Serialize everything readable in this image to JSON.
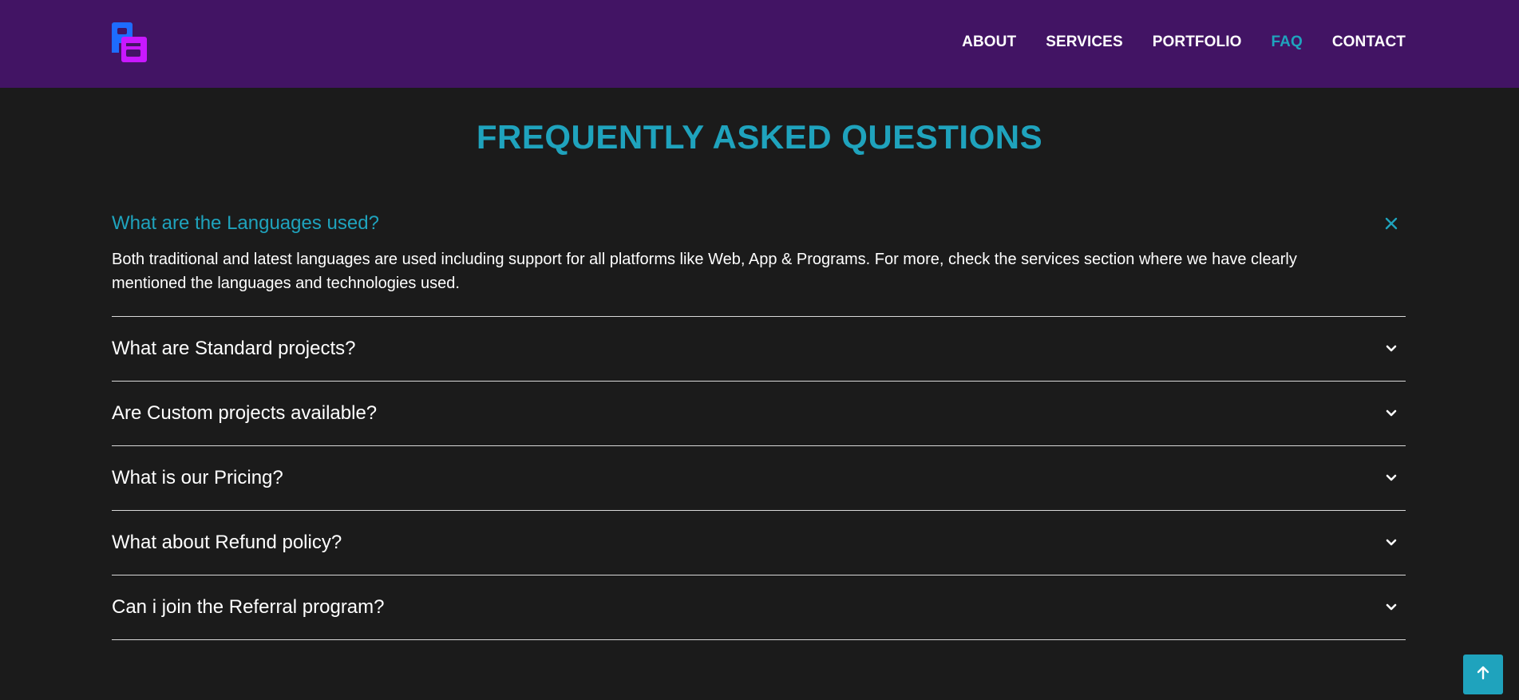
{
  "nav": {
    "logo": "logo",
    "links": [
      "ABOUT",
      "SERVICES",
      "PORTFOLIO",
      "FAQ",
      "CONTACT"
    ],
    "active": "FAQ"
  },
  "page": {
    "title": "FREQUENTLY ASKED QUESTIONS"
  },
  "faq": {
    "items": [
      {
        "question": "What are the Languages used?",
        "answer": "Both traditional and latest languages are used including support for all platforms like Web, App & Programs. For more, check the services section where we have clearly mentioned the languages and technologies used.",
        "open": true
      },
      {
        "question": "What are Standard projects?",
        "open": false
      },
      {
        "question": "Are Custom projects available?",
        "open": false
      },
      {
        "question": "What is our Pricing?",
        "open": false
      },
      {
        "question": "What about Refund policy?",
        "open": false
      },
      {
        "question": "Can i join the Referral program?",
        "open": false
      }
    ]
  },
  "colors": {
    "nav_bg": "#421464",
    "page_bg": "#1b1b1b",
    "accent": "#1fa3bd",
    "logo_blue": "#1e6cff",
    "logo_magenta": "#c818ff"
  },
  "icons": {
    "close": "close-icon",
    "expand": "chevron-down-icon",
    "scroll_top": "arrow-up-icon"
  }
}
